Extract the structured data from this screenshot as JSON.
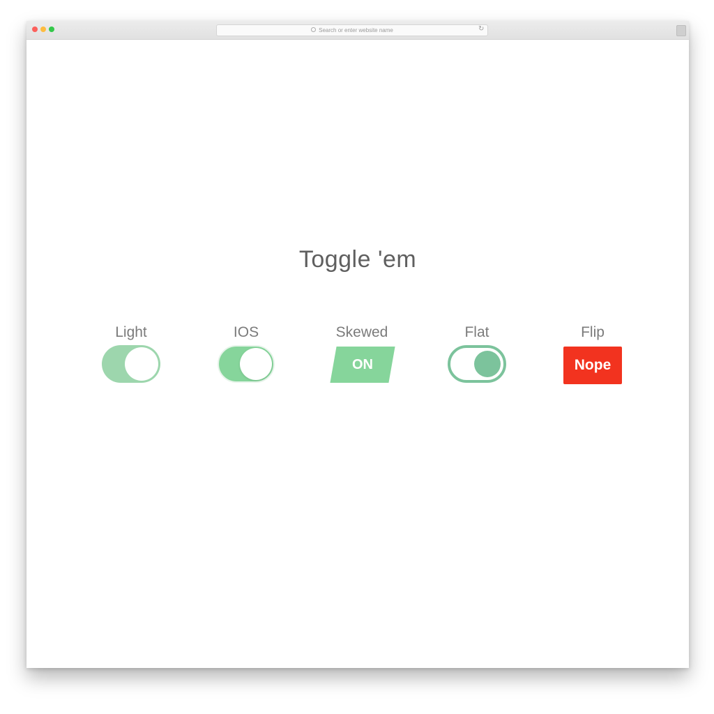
{
  "browser": {
    "address_placeholder": "Search or enter website name",
    "reload_glyph": "↻"
  },
  "page": {
    "title": "Toggle 'em"
  },
  "toggles": [
    {
      "label": "Light",
      "state": "on",
      "color": "#9dd6ad"
    },
    {
      "label": "IOS",
      "state": "on",
      "color": "#86d59b"
    },
    {
      "label": "Skewed",
      "state": "on",
      "text": "ON",
      "color": "#86d59b"
    },
    {
      "label": "Flat",
      "state": "on",
      "color": "#7cc39c"
    },
    {
      "label": "Flip",
      "state": "off",
      "text": "Nope",
      "color": "#f2331f"
    }
  ]
}
